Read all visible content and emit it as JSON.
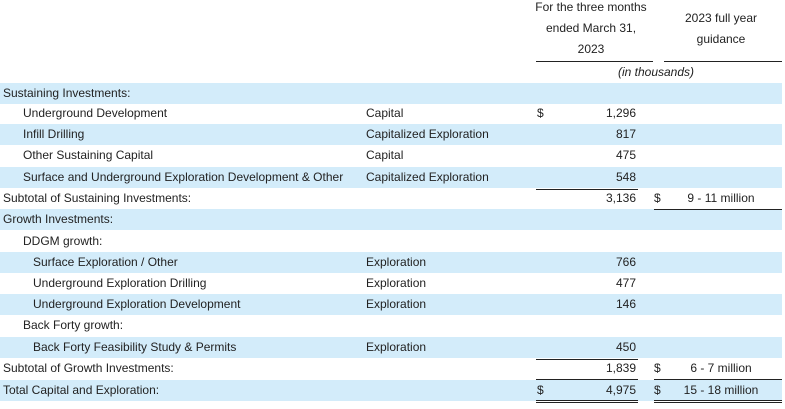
{
  "header": {
    "col_q1_lines": [
      "For the three months",
      "ended March 31,",
      "2023"
    ],
    "col_guidance_lines": [
      "2023 full year",
      "guidance"
    ],
    "units": "(in thousands)"
  },
  "rows": [
    {
      "label": "Sustaining Investments:",
      "indent": 0,
      "type": "",
      "cur1": "",
      "value": "",
      "cur2": "",
      "guidance": "",
      "shade": true
    },
    {
      "label": "Underground Development",
      "indent": 1,
      "type": "Capital",
      "cur1": "$",
      "value": "1,296",
      "cur2": "",
      "guidance": "",
      "shade": false
    },
    {
      "label": "Infill Drilling",
      "indent": 1,
      "type": "Capitalized Exploration",
      "cur1": "",
      "value": "817",
      "cur2": "",
      "guidance": "",
      "shade": true
    },
    {
      "label": "Other Sustaining Capital",
      "indent": 1,
      "type": "Capital",
      "cur1": "",
      "value": "475",
      "cur2": "",
      "guidance": "",
      "shade": false
    },
    {
      "label": "Surface and Underground Exploration Development & Other",
      "indent": 1,
      "type": "Capitalized Exploration",
      "cur1": "",
      "value": "548",
      "cur2": "",
      "guidance": "",
      "shade": true
    },
    {
      "label": "Subtotal of Sustaining Investments:",
      "indent": 0,
      "type": "",
      "cur1": "",
      "value": "3,136",
      "cur2": "$",
      "guidance": "9 - 11 million",
      "shade": false
    },
    {
      "label": "Growth Investments:",
      "indent": 0,
      "type": "",
      "cur1": "",
      "value": "",
      "cur2": "",
      "guidance": "",
      "shade": true
    },
    {
      "label": "DDGM growth:",
      "indent": 1,
      "type": "",
      "cur1": "",
      "value": "",
      "cur2": "",
      "guidance": "",
      "shade": false
    },
    {
      "label": "Surface Exploration / Other",
      "indent": 2,
      "type": "Exploration",
      "cur1": "",
      "value": "766",
      "cur2": "",
      "guidance": "",
      "shade": true
    },
    {
      "label": "Underground Exploration Drilling",
      "indent": 2,
      "type": "Exploration",
      "cur1": "",
      "value": "477",
      "cur2": "",
      "guidance": "",
      "shade": false
    },
    {
      "label": "Underground Exploration Development",
      "indent": 2,
      "type": "Exploration",
      "cur1": "",
      "value": "146",
      "cur2": "",
      "guidance": "",
      "shade": true
    },
    {
      "label": "Back Forty growth:",
      "indent": 1,
      "type": "",
      "cur1": "",
      "value": "",
      "cur2": "",
      "guidance": "",
      "shade": false
    },
    {
      "label": "Back Forty Feasibility Study & Permits",
      "indent": 2,
      "type": "Exploration",
      "cur1": "",
      "value": "450",
      "cur2": "",
      "guidance": "",
      "shade": true
    },
    {
      "label": "Subtotal of Growth Investments:",
      "indent": 0,
      "type": "",
      "cur1": "",
      "value": "1,839",
      "cur2": "$",
      "guidance": "6 - 7 million",
      "shade": false
    },
    {
      "label": "Total Capital and Exploration:",
      "indent": 0,
      "type": "",
      "cur1": "$",
      "value": "4,975",
      "cur2": "$",
      "guidance": "15 - 18 million",
      "shade": true
    }
  ]
}
